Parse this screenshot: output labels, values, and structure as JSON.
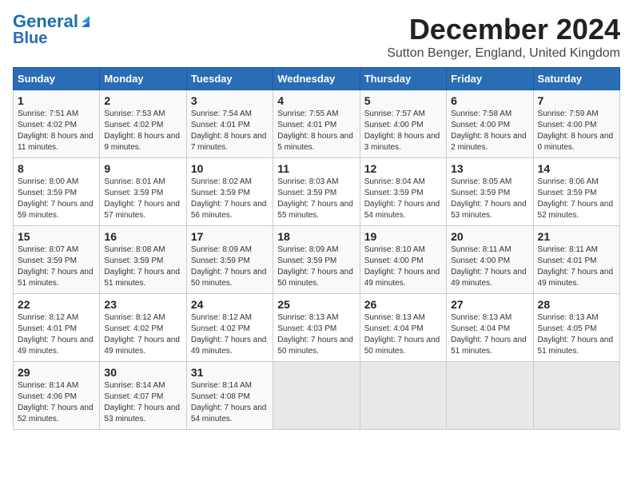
{
  "header": {
    "logo_line1": "General",
    "logo_line2": "Blue",
    "month": "December 2024",
    "location": "Sutton Benger, England, United Kingdom"
  },
  "days_of_week": [
    "Sunday",
    "Monday",
    "Tuesday",
    "Wednesday",
    "Thursday",
    "Friday",
    "Saturday"
  ],
  "weeks": [
    [
      {
        "day": "1",
        "info": "Sunrise: 7:51 AM\nSunset: 4:02 PM\nDaylight: 8 hours and 11 minutes."
      },
      {
        "day": "2",
        "info": "Sunrise: 7:53 AM\nSunset: 4:02 PM\nDaylight: 8 hours and 9 minutes."
      },
      {
        "day": "3",
        "info": "Sunrise: 7:54 AM\nSunset: 4:01 PM\nDaylight: 8 hours and 7 minutes."
      },
      {
        "day": "4",
        "info": "Sunrise: 7:55 AM\nSunset: 4:01 PM\nDaylight: 8 hours and 5 minutes."
      },
      {
        "day": "5",
        "info": "Sunrise: 7:57 AM\nSunset: 4:00 PM\nDaylight: 8 hours and 3 minutes."
      },
      {
        "day": "6",
        "info": "Sunrise: 7:58 AM\nSunset: 4:00 PM\nDaylight: 8 hours and 2 minutes."
      },
      {
        "day": "7",
        "info": "Sunrise: 7:59 AM\nSunset: 4:00 PM\nDaylight: 8 hours and 0 minutes."
      }
    ],
    [
      {
        "day": "8",
        "info": "Sunrise: 8:00 AM\nSunset: 3:59 PM\nDaylight: 7 hours and 59 minutes."
      },
      {
        "day": "9",
        "info": "Sunrise: 8:01 AM\nSunset: 3:59 PM\nDaylight: 7 hours and 57 minutes."
      },
      {
        "day": "10",
        "info": "Sunrise: 8:02 AM\nSunset: 3:59 PM\nDaylight: 7 hours and 56 minutes."
      },
      {
        "day": "11",
        "info": "Sunrise: 8:03 AM\nSunset: 3:59 PM\nDaylight: 7 hours and 55 minutes."
      },
      {
        "day": "12",
        "info": "Sunrise: 8:04 AM\nSunset: 3:59 PM\nDaylight: 7 hours and 54 minutes."
      },
      {
        "day": "13",
        "info": "Sunrise: 8:05 AM\nSunset: 3:59 PM\nDaylight: 7 hours and 53 minutes."
      },
      {
        "day": "14",
        "info": "Sunrise: 8:06 AM\nSunset: 3:59 PM\nDaylight: 7 hours and 52 minutes."
      }
    ],
    [
      {
        "day": "15",
        "info": "Sunrise: 8:07 AM\nSunset: 3:59 PM\nDaylight: 7 hours and 51 minutes."
      },
      {
        "day": "16",
        "info": "Sunrise: 8:08 AM\nSunset: 3:59 PM\nDaylight: 7 hours and 51 minutes."
      },
      {
        "day": "17",
        "info": "Sunrise: 8:09 AM\nSunset: 3:59 PM\nDaylight: 7 hours and 50 minutes."
      },
      {
        "day": "18",
        "info": "Sunrise: 8:09 AM\nSunset: 3:59 PM\nDaylight: 7 hours and 50 minutes."
      },
      {
        "day": "19",
        "info": "Sunrise: 8:10 AM\nSunset: 4:00 PM\nDaylight: 7 hours and 49 minutes."
      },
      {
        "day": "20",
        "info": "Sunrise: 8:11 AM\nSunset: 4:00 PM\nDaylight: 7 hours and 49 minutes."
      },
      {
        "day": "21",
        "info": "Sunrise: 8:11 AM\nSunset: 4:01 PM\nDaylight: 7 hours and 49 minutes."
      }
    ],
    [
      {
        "day": "22",
        "info": "Sunrise: 8:12 AM\nSunset: 4:01 PM\nDaylight: 7 hours and 49 minutes."
      },
      {
        "day": "23",
        "info": "Sunrise: 8:12 AM\nSunset: 4:02 PM\nDaylight: 7 hours and 49 minutes."
      },
      {
        "day": "24",
        "info": "Sunrise: 8:12 AM\nSunset: 4:02 PM\nDaylight: 7 hours and 49 minutes."
      },
      {
        "day": "25",
        "info": "Sunrise: 8:13 AM\nSunset: 4:03 PM\nDaylight: 7 hours and 50 minutes."
      },
      {
        "day": "26",
        "info": "Sunrise: 8:13 AM\nSunset: 4:04 PM\nDaylight: 7 hours and 50 minutes."
      },
      {
        "day": "27",
        "info": "Sunrise: 8:13 AM\nSunset: 4:04 PM\nDaylight: 7 hours and 51 minutes."
      },
      {
        "day": "28",
        "info": "Sunrise: 8:13 AM\nSunset: 4:05 PM\nDaylight: 7 hours and 51 minutes."
      }
    ],
    [
      {
        "day": "29",
        "info": "Sunrise: 8:14 AM\nSunset: 4:06 PM\nDaylight: 7 hours and 52 minutes."
      },
      {
        "day": "30",
        "info": "Sunrise: 8:14 AM\nSunset: 4:07 PM\nDaylight: 7 hours and 53 minutes."
      },
      {
        "day": "31",
        "info": "Sunrise: 8:14 AM\nSunset: 4:08 PM\nDaylight: 7 hours and 54 minutes."
      },
      {
        "day": "",
        "info": ""
      },
      {
        "day": "",
        "info": ""
      },
      {
        "day": "",
        "info": ""
      },
      {
        "day": "",
        "info": ""
      }
    ]
  ]
}
